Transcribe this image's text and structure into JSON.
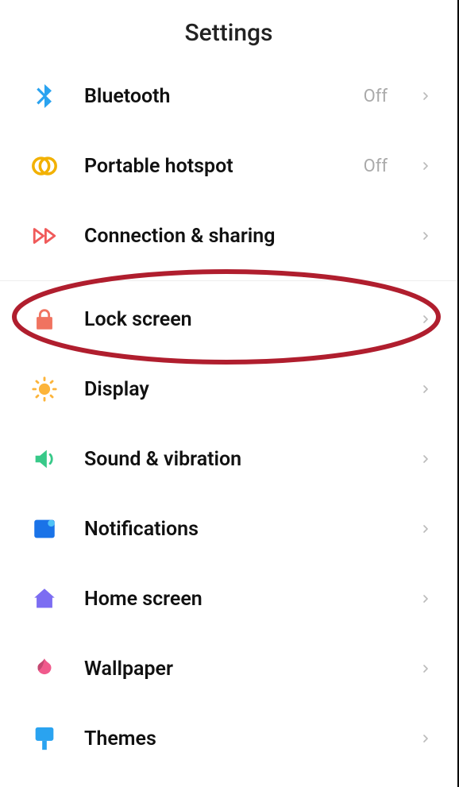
{
  "header": {
    "title": "Settings"
  },
  "groups": [
    {
      "items": [
        {
          "id": "bluetooth",
          "label": "Bluetooth",
          "value": "Off",
          "icon": "bluetooth-icon",
          "color": "#2aa3f0"
        },
        {
          "id": "hotspot",
          "label": "Portable hotspot",
          "value": "Off",
          "icon": "hotspot-icon",
          "color": "#f2b100"
        },
        {
          "id": "connection",
          "label": "Connection & sharing",
          "value": "",
          "icon": "connection-icon",
          "color": "#f05a5a"
        }
      ]
    },
    {
      "items": [
        {
          "id": "lockscreen",
          "label": "Lock screen",
          "value": "",
          "icon": "lock-icon",
          "color": "#f07360"
        },
        {
          "id": "display",
          "label": "Display",
          "value": "",
          "icon": "sun-icon",
          "color": "#fcb43a"
        },
        {
          "id": "sound",
          "label": "Sound & vibration",
          "value": "",
          "icon": "sound-icon",
          "color": "#38c989"
        },
        {
          "id": "notifications",
          "label": "Notifications",
          "value": "",
          "icon": "notification-icon",
          "color": "#1a73e8"
        },
        {
          "id": "homescreen",
          "label": "Home screen",
          "value": "",
          "icon": "home-icon",
          "color": "#7c6df2"
        },
        {
          "id": "wallpaper",
          "label": "Wallpaper",
          "value": "",
          "icon": "wallpaper-icon",
          "color": "#f05a8c"
        },
        {
          "id": "themes",
          "label": "Themes",
          "value": "",
          "icon": "themes-icon",
          "color": "#2aa3f0"
        }
      ]
    }
  ]
}
